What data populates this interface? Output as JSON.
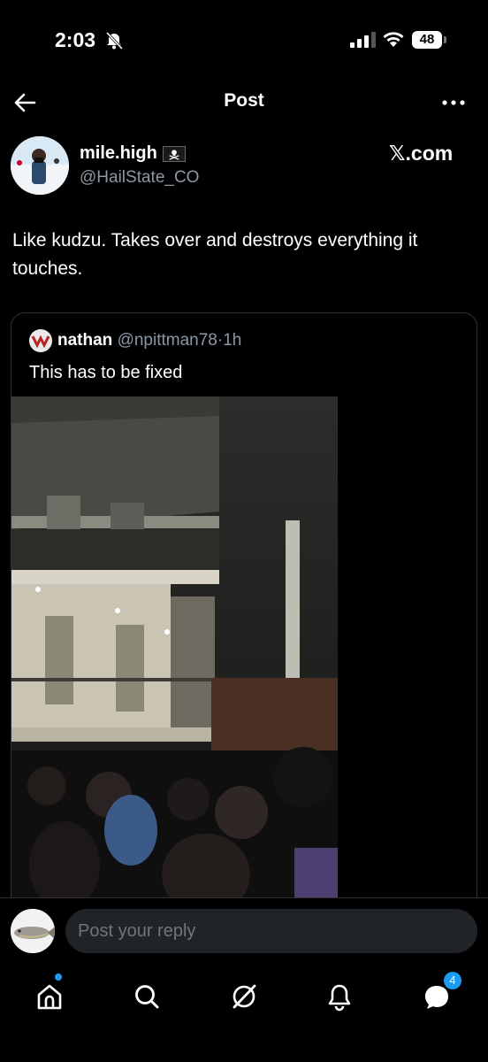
{
  "status_bar": {
    "time": "2:03",
    "battery": "48"
  },
  "header": {
    "title": "Post"
  },
  "author": {
    "name": "mile.high",
    "handle": "@HailState_CO",
    "source": "𝕏.com"
  },
  "post": {
    "text": "Like kudzu. Takes over and destroys everything it touches."
  },
  "quoted": {
    "name": "nathan",
    "handle": "@npittman78",
    "separator": "·",
    "time": "1h",
    "text": "This has to be fixed"
  },
  "reply": {
    "placeholder": "Post your reply"
  },
  "nav": {
    "items": [
      "home-icon",
      "search-icon",
      "grok-icon",
      "notifications-icon",
      "messages-icon"
    ],
    "messages_badge": "4"
  },
  "colors": {
    "accent": "#1d9bf0",
    "background": "#000000",
    "secondary_text": "#8b98a5"
  }
}
